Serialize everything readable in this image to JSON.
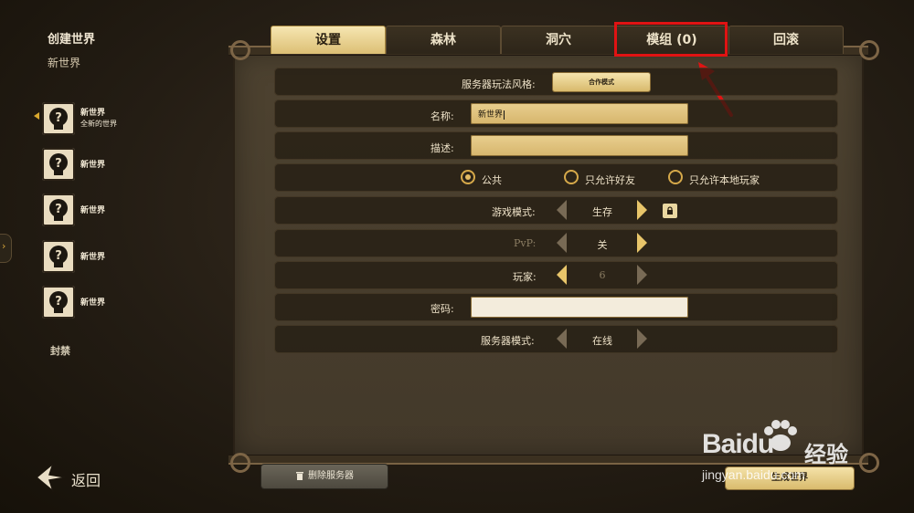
{
  "sidebar": {
    "title": "创建世界",
    "subtitle": "新世界",
    "slots": [
      {
        "name": "新世界",
        "desc": "全新的世界"
      },
      {
        "name": "新世界"
      },
      {
        "name": "新世界"
      },
      {
        "name": "新世界"
      },
      {
        "name": "新世界"
      }
    ],
    "banned": "封禁",
    "back": "返回"
  },
  "tabs": [
    "设置",
    "森林",
    "洞穴",
    "模组 (0)",
    "回滚"
  ],
  "active_tab": "设置",
  "settings": {
    "playstyle_label": "服务器玩法风格:",
    "playstyle_value": "合作模式",
    "name_label": "名称:",
    "name_value": "新世界",
    "desc_label": "描述:",
    "desc_value": "",
    "privacy_options": [
      "公共",
      "只允许好友",
      "只允许本地玩家"
    ],
    "privacy_selected": "公共",
    "gamemode_label": "游戏模式:",
    "gamemode_value": "生存",
    "pvp_label": "PvP:",
    "pvp_value": "关",
    "players_label": "玩家:",
    "players_value": "6",
    "password_label": "密码:",
    "password_value": "",
    "servermode_label": "服务器模式:",
    "servermode_value": "在线"
  },
  "buttons": {
    "delete": "删除服务器",
    "generate": "生成世界"
  },
  "watermark": {
    "logo": "Baidu",
    "cn": "经验",
    "url": "jingyan.baidu.com"
  },
  "colors": {
    "accent_gold": "#dcbf74",
    "highlight_red": "#e01313",
    "panel_bg": "#4d4230"
  }
}
